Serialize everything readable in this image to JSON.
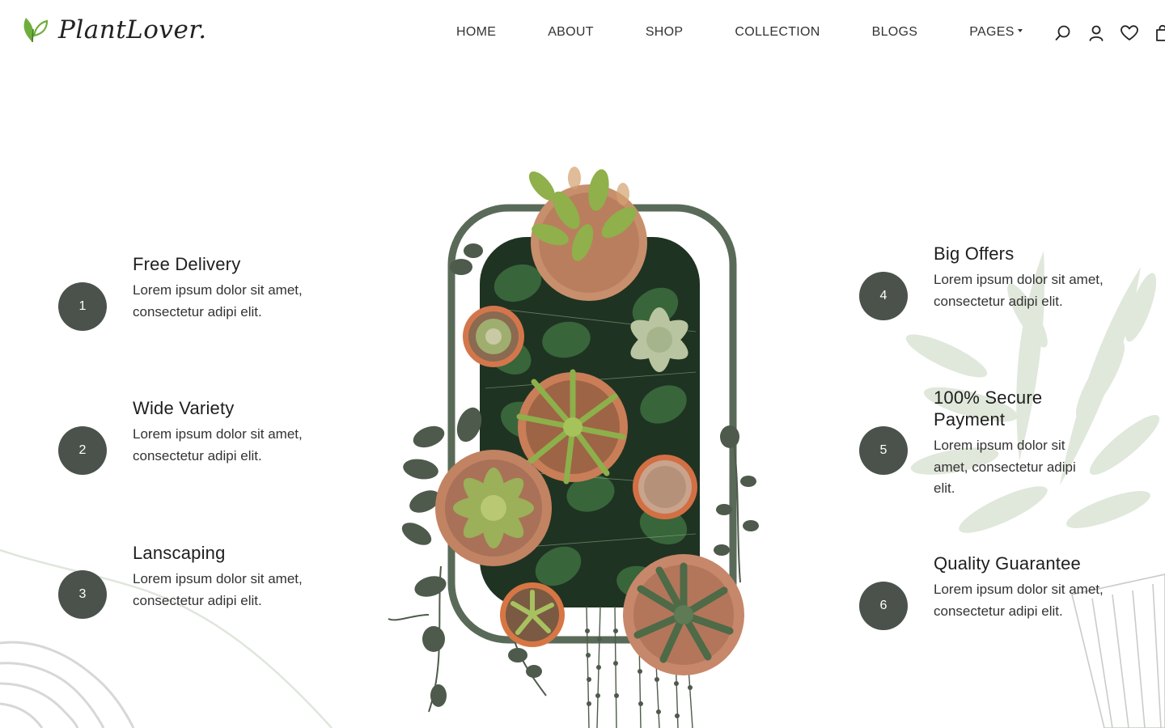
{
  "brand": {
    "name": "PlantLover.",
    "accent": "#6fae3c",
    "dark": "#4b524b",
    "frame": "#5a6a58"
  },
  "nav": [
    {
      "label": "HOME"
    },
    {
      "label": "ABOUT"
    },
    {
      "label": "SHOP"
    },
    {
      "label": "COLLECTION"
    },
    {
      "label": "BLOGS"
    },
    {
      "label": "PAGES",
      "dropdown": true
    }
  ],
  "header_icons": [
    "search-icon",
    "user-icon",
    "heart-icon",
    "bag-icon"
  ],
  "features_left": [
    {
      "number": "1",
      "title": "Free Delivery",
      "text": "Lorem ipsum dolor sit amet, consectetur adipi elit."
    },
    {
      "number": "2",
      "title": "Wide Variety",
      "text": "Lorem ipsum dolor sit amet, consectetur adipi elit."
    },
    {
      "number": "3",
      "title": "Lanscaping",
      "text": "Lorem ipsum dolor sit amet, consectetur adipi elit."
    }
  ],
  "features_right": [
    {
      "number": "4",
      "title": "Big Offers",
      "text": "Lorem ipsum dolor sit amet, consectetur adipi elit."
    },
    {
      "number": "5",
      "title": "100% Secure Payment",
      "text": "Lorem ipsum dolor sit amet, consectetur adipi elit."
    },
    {
      "number": "6",
      "title": "Quality Guarantee",
      "text": "Lorem ipsum dolor sit amet, consectetur adipi elit."
    }
  ]
}
